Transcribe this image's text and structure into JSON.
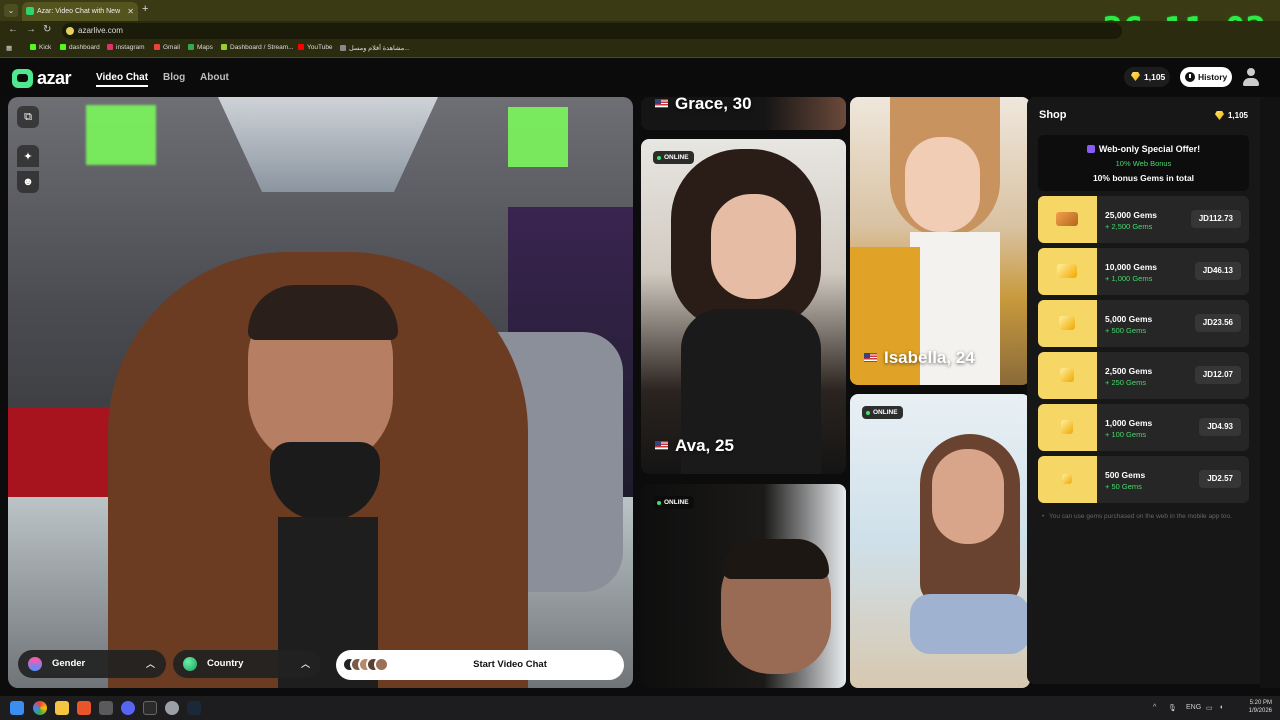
{
  "browser": {
    "tab_title": "Azar: Video Chat with New",
    "new_tab": "+",
    "url": "azarlive.com",
    "bookmarks": [
      "Kick",
      "dashboard",
      "instagram",
      "Gmail",
      "Maps",
      "Dashboard / Stream...",
      "YouTube",
      "مشاهدة أفلام ومسل..."
    ],
    "bookmark_colors": [
      "#53fc18",
      "#53fc18",
      "#e1306c",
      "#ea4335",
      "#34a853",
      "#9acd32",
      "#ff0000",
      "#888888"
    ]
  },
  "overlay_timer": "36:11:02",
  "header": {
    "logo": "azar",
    "nav": [
      "Video Chat",
      "Blog",
      "About"
    ],
    "gems": "1,105",
    "history": "History"
  },
  "camera": {
    "gender_label": "Gender",
    "country_label": "Country",
    "start_label": "Start Video Chat"
  },
  "cards": [
    {
      "name": "Grace, 30",
      "online": ""
    },
    {
      "name": "Ava, 25",
      "online": "ONLINE"
    },
    {
      "name": "Isabella, 24",
      "online": ""
    },
    {
      "name": "",
      "online": "ONLINE"
    },
    {
      "name": "",
      "online": "ONLINE"
    }
  ],
  "shop": {
    "title": "Shop",
    "balance": "1,105",
    "offer_title": "Web-only Special Offer!",
    "offer_sub": "10% Web Bonus",
    "offer_desc": "10% bonus Gems in total",
    "packages": [
      {
        "gems": "25,000 Gems",
        "bonus": "+ 2,500 Gems",
        "price": "JD112.73"
      },
      {
        "gems": "10,000 Gems",
        "bonus": "+ 1,000 Gems",
        "price": "JD46.13"
      },
      {
        "gems": "5,000 Gems",
        "bonus": "+ 500 Gems",
        "price": "JD23.56"
      },
      {
        "gems": "2,500 Gems",
        "bonus": "+ 250 Gems",
        "price": "JD12.07"
      },
      {
        "gems": "1,000 Gems",
        "bonus": "+ 100 Gems",
        "price": "JD4.93"
      },
      {
        "gems": "500 Gems",
        "bonus": "+ 50 Gems",
        "price": "JD2.57"
      }
    ],
    "note": "You can use gems purchased on the web in the mobile app too."
  },
  "taskbar": {
    "lang": "ENG",
    "time": "5:20 PM",
    "date": "1/9/2026"
  }
}
